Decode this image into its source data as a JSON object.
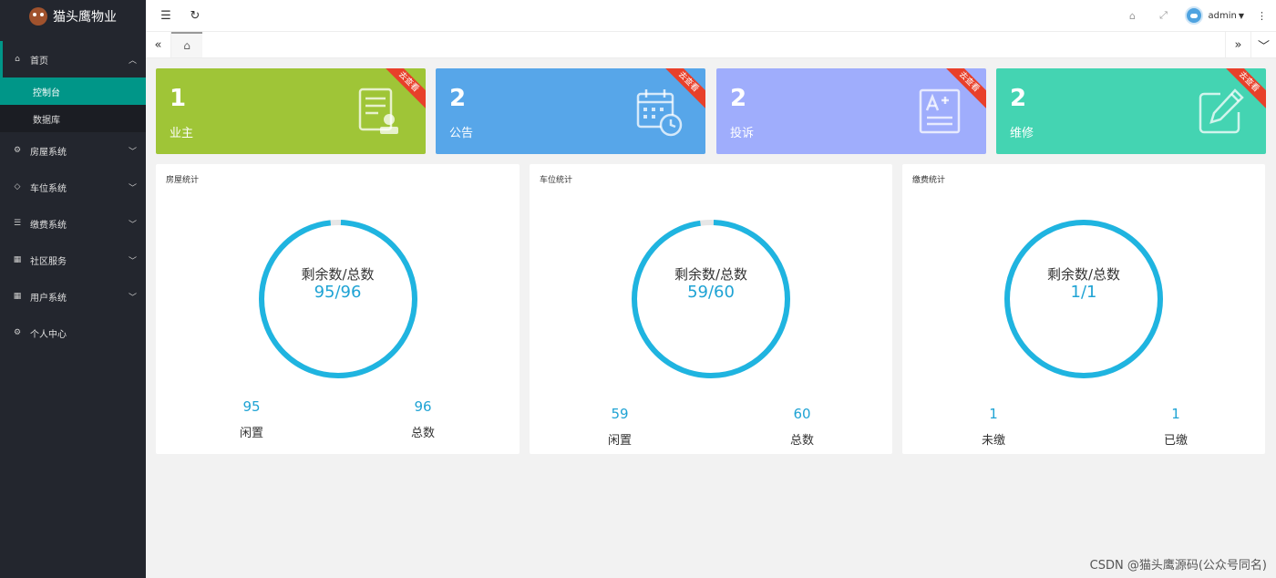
{
  "app": {
    "title": "猫头鹰物业"
  },
  "sidebar": {
    "items": [
      {
        "label": "首页",
        "icon": "home-icon",
        "expanded": true,
        "children": [
          {
            "label": "控制台",
            "active": true
          },
          {
            "label": "数据库"
          }
        ]
      },
      {
        "label": "房屋系统",
        "icon": "gear-icon"
      },
      {
        "label": "车位系统",
        "icon": "cube-icon"
      },
      {
        "label": "缴费系统",
        "icon": "list-icon"
      },
      {
        "label": "社区服务",
        "icon": "grid-icon"
      },
      {
        "label": "用户系统",
        "icon": "grid-icon"
      },
      {
        "label": "个人中心",
        "icon": "gear-icon"
      }
    ]
  },
  "header": {
    "username": "admin"
  },
  "cards": [
    {
      "value": "1",
      "label": "业主",
      "ribbon": "去查看",
      "color": "#9fc537",
      "icon": "certificate-icon"
    },
    {
      "value": "2",
      "label": "公告",
      "ribbon": "去查看",
      "color": "#57a6e9",
      "icon": "calendar-clock-icon"
    },
    {
      "value": "2",
      "label": "投诉",
      "ribbon": "去查看",
      "color": "#9fadfc",
      "icon": "document-edit-icon"
    },
    {
      "value": "2",
      "label": "维修",
      "ribbon": "去查看",
      "color": "#44d4b2",
      "icon": "pencil-square-icon"
    }
  ],
  "panels": [
    {
      "title": "房屋统计",
      "caption": "剩余数/总数",
      "ratio": "95/96",
      "remaining": 95,
      "total": 96,
      "left": {
        "value": "95",
        "label": "闲置"
      },
      "right": {
        "value": "96",
        "label": "总数"
      }
    },
    {
      "title": "车位统计",
      "caption": "剩余数/总数",
      "ratio": "59/60",
      "remaining": 59,
      "total": 60,
      "left": {
        "value": "59",
        "label": "闲置"
      },
      "right": {
        "value": "60",
        "label": "总数"
      }
    },
    {
      "title": "缴费统计",
      "caption": "剩余数/总数",
      "ratio": "1/1",
      "remaining": 1,
      "total": 1,
      "left": {
        "value": "1",
        "label": "未缴"
      },
      "right": {
        "value": "1",
        "label": "已缴"
      }
    }
  ],
  "watermark": "CSDN @猫头鹰源码(公众号同名)",
  "colors": {
    "accent": "#009688",
    "gauge": "#1fb4e0",
    "gauge_bg": "#e6e6e6",
    "sidebar": "#23262e"
  }
}
